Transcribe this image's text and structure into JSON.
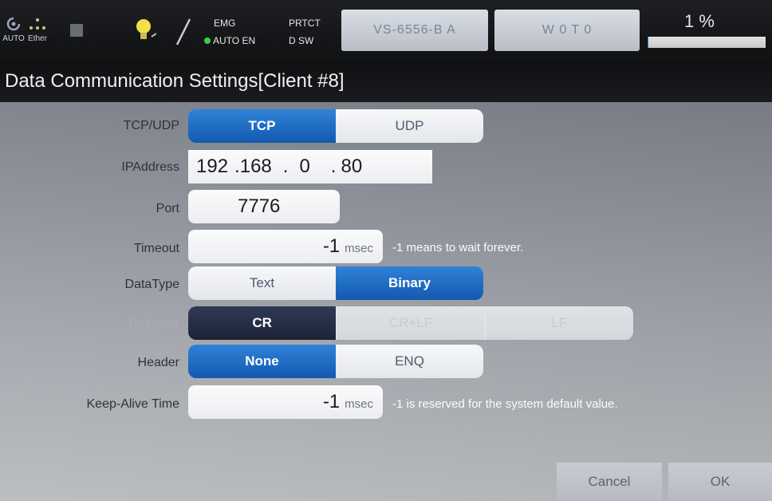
{
  "top": {
    "icons": [
      {
        "name": "auto-icon",
        "label": "AUTO"
      },
      {
        "name": "ether-icon",
        "label": "Ether"
      }
    ],
    "status": {
      "emg": "EMG",
      "auto_en": "AUTO EN",
      "prtct": "PRTCT",
      "dsw": "D SW"
    },
    "model_button": "VS-6556-B A",
    "mode_button": "W 0 T 0",
    "percent": "1 %",
    "percent_value": 1
  },
  "title": "Data Communication Settings[Client #8]",
  "form": {
    "tcp_udp": {
      "label": "TCP/UDP",
      "options": [
        "TCP",
        "UDP"
      ]
    },
    "ip": {
      "label": "IPAddress",
      "octets": [
        "192",
        "168",
        "0",
        "80"
      ]
    },
    "port": {
      "label": "Port",
      "value": "7776"
    },
    "timeout": {
      "label": "Timeout",
      "value": "-1",
      "unit": "msec",
      "note": "-1 means to wait forever."
    },
    "datatype": {
      "label": "DataType",
      "options": [
        "Text",
        "Binary"
      ]
    },
    "delimiter": {
      "label": "Delimiter",
      "options": [
        "CR",
        "CR+LF",
        "LF"
      ]
    },
    "header": {
      "label": "Header",
      "options": [
        "None",
        "ENQ"
      ]
    },
    "keepalive": {
      "label": "Keep-Alive Time",
      "value": "-1",
      "unit": "msec",
      "note": "-1 is reserved for the system default value."
    }
  },
  "buttons": {
    "cancel": "Cancel",
    "ok": "OK"
  },
  "colors": {
    "accent": "#1e6ccc",
    "dark_selected": "#22293f",
    "progress": "#3a74c2"
  }
}
